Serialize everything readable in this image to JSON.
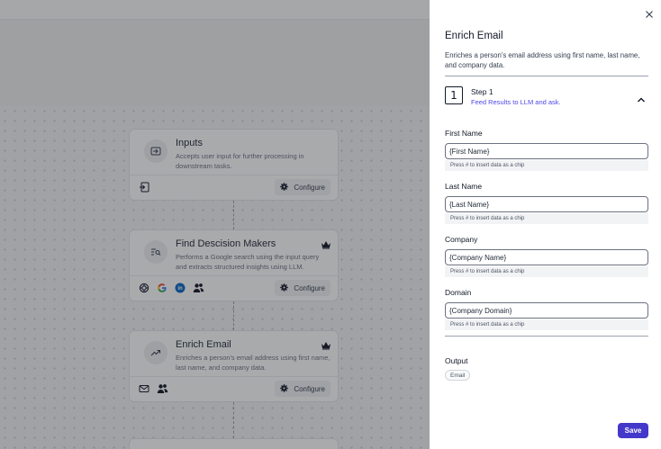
{
  "canvas": {
    "nodes": [
      {
        "title": "Inputs",
        "description": "Accepts user input for further processing in downstream tasks.",
        "configure_label": "Configure",
        "premium": false,
        "tools": [
          "input-icon"
        ]
      },
      {
        "title": "Find Descision Makers",
        "description": "Performs a Google search using the input query and extracts structured insights using LLM.",
        "configure_label": "Configure",
        "premium": true,
        "tools": [
          "openai-icon",
          "google-icon",
          "linkedin-icon",
          "people-icon"
        ]
      },
      {
        "title": "Enrich Email",
        "description": "Enriches a person's email address using first name, last name, and company data.",
        "configure_label": "Configure",
        "premium": true,
        "tools": [
          "mail-icon",
          "people-icon"
        ]
      }
    ]
  },
  "panel": {
    "title": "Enrich Email",
    "description": "Enriches a person's email address using first name, last name, and company data.",
    "step": {
      "number": "1",
      "title": "Step 1",
      "subtitle": "Feed Results to LLM and ask."
    },
    "fields": [
      {
        "label": "First Name",
        "value": "{First Name}",
        "hint": "Press # to insert data as a chip"
      },
      {
        "label": "Last Name",
        "value": "{Last Name}",
        "hint": "Press # to insert data as a chip"
      },
      {
        "label": "Company",
        "value": "{Company Name}",
        "hint": "Press # to insert data as a chip"
      },
      {
        "label": "Domain",
        "value": "{Company Domain}",
        "hint": "Press # to insert data as a chip"
      }
    ],
    "output": {
      "label": "Output",
      "chip": "Email"
    },
    "save_label": "Save"
  },
  "colors": {
    "accent": "#4338ca",
    "step_link": "#4f46e5",
    "overlay": "rgba(30,32,38,0.38)"
  }
}
